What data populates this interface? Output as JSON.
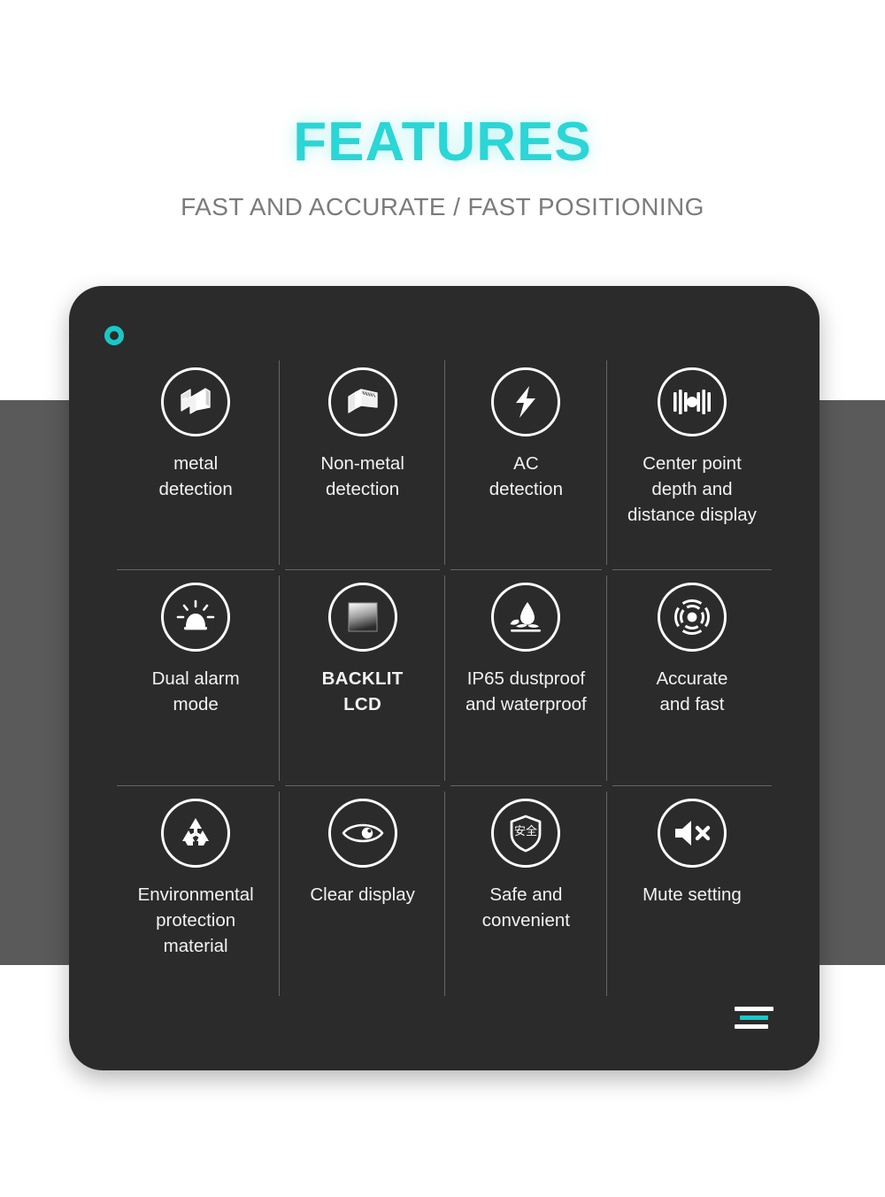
{
  "header": {
    "title": "FEATURES",
    "subtitle": "FAST AND ACCURATE / FAST POSITIONING"
  },
  "colors": {
    "accent": "#2ad6d6",
    "accent_dot": "#18c8c8",
    "card_bg": "#2b2b2b",
    "page_bg": "#ffffff",
    "band_bg": "#5a5a5a",
    "subtitle_text": "#7b7b7b",
    "cell_text": "#f2f2f2",
    "divider": "rgba(255,255,255,0.28)"
  },
  "card": {
    "dot_icon": "ring-icon",
    "mark_icon": "three-line-mark-icon"
  },
  "features": [
    {
      "icon": "metal-block-icon",
      "label": "metal\ndetection",
      "bold": false
    },
    {
      "icon": "non-metal-board-icon",
      "label": "Non-metal\ndetection",
      "bold": false
    },
    {
      "icon": "lightning-bolt-icon",
      "label": "AC\ndetection",
      "bold": false
    },
    {
      "icon": "center-point-bars-icon",
      "label": "Center point\ndepth and\ndistance display",
      "bold": false
    },
    {
      "icon": "alarm-siren-icon",
      "label": "Dual alarm\nmode",
      "bold": false
    },
    {
      "icon": "backlit-screen-icon",
      "label": "BACKLIT\nLCD",
      "bold": true
    },
    {
      "icon": "water-drop-icon",
      "label": "IP65 dustproof\nand waterproof",
      "bold": false
    },
    {
      "icon": "target-radar-icon",
      "label": "Accurate\nand fast",
      "bold": false
    },
    {
      "icon": "recycle-icon",
      "label": "Environmental\nprotection\nmaterial",
      "bold": false
    },
    {
      "icon": "eye-icon",
      "label": "Clear display",
      "bold": false
    },
    {
      "icon": "safety-shield-icon",
      "label": "Safe and\nconvenient",
      "bold": false,
      "glyph": "安全"
    },
    {
      "icon": "mute-speaker-icon",
      "label": "Mute setting",
      "bold": false
    }
  ]
}
